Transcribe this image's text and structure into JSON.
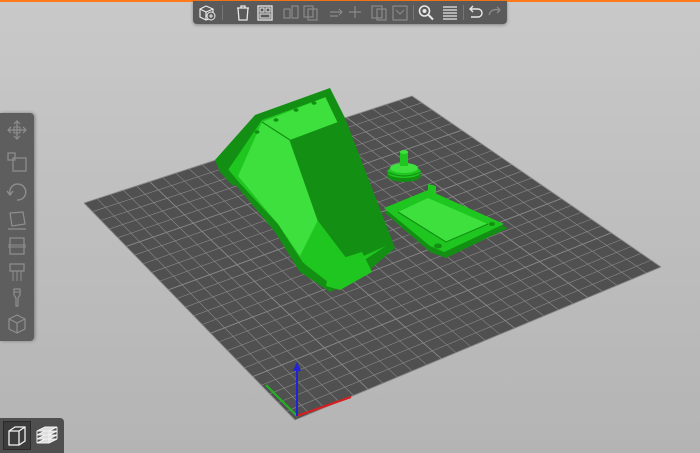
{
  "app": {
    "accent_color": "#ff7a1a",
    "bed_color": "#505050",
    "grid_line_color": "#8a8a8a",
    "model_color": "#1fc61f",
    "model_shadow_color": "#139013",
    "x_axis_color": "#d81e1e",
    "y_axis_color": "#22b322",
    "z_axis_color": "#2222d8"
  },
  "top_toolbar": {
    "buttons": [
      {
        "id": "add",
        "icon": "add-object-icon",
        "enabled": true
      },
      {
        "id": "delete",
        "icon": "delete-icon",
        "enabled": true
      },
      {
        "id": "delete-all",
        "icon": "delete-all-icon",
        "enabled": true
      },
      {
        "id": "arrange",
        "icon": "arrange-icon",
        "enabled": false
      },
      {
        "id": "copy",
        "icon": "copy-icon",
        "enabled": false
      },
      {
        "id": "paste",
        "icon": "paste-icon",
        "enabled": false
      },
      {
        "id": "add-instance",
        "icon": "add-instance-icon",
        "enabled": false
      },
      {
        "id": "remove-instance",
        "icon": "remove-instance-icon",
        "enabled": false
      },
      {
        "id": "split-objects",
        "icon": "split-objects-icon",
        "enabled": false
      },
      {
        "id": "split-parts",
        "icon": "split-parts-icon",
        "enabled": false
      },
      {
        "id": "search",
        "icon": "search-icon",
        "enabled": true
      },
      {
        "id": "layers",
        "icon": "layers-editing-icon",
        "enabled": true
      },
      {
        "id": "undo",
        "icon": "undo-icon",
        "enabled": true
      },
      {
        "id": "redo",
        "icon": "redo-icon",
        "enabled": false
      }
    ]
  },
  "left_toolbar": {
    "tools": [
      {
        "id": "move",
        "icon": "move-icon"
      },
      {
        "id": "scale",
        "icon": "scale-icon"
      },
      {
        "id": "rotate",
        "icon": "rotate-icon"
      },
      {
        "id": "place-on-face",
        "icon": "place-on-face-icon"
      },
      {
        "id": "cut",
        "icon": "cut-icon"
      },
      {
        "id": "support-painting",
        "icon": "support-painting-icon"
      },
      {
        "id": "seam-painting",
        "icon": "seam-painting-icon"
      },
      {
        "id": "variable-layer-height",
        "icon": "variable-layer-height-icon"
      }
    ]
  },
  "view_toggle": {
    "options": [
      {
        "id": "3d-view",
        "icon": "3d-view-icon",
        "active": true
      },
      {
        "id": "preview",
        "icon": "preview-layers-icon",
        "active": false
      }
    ]
  }
}
